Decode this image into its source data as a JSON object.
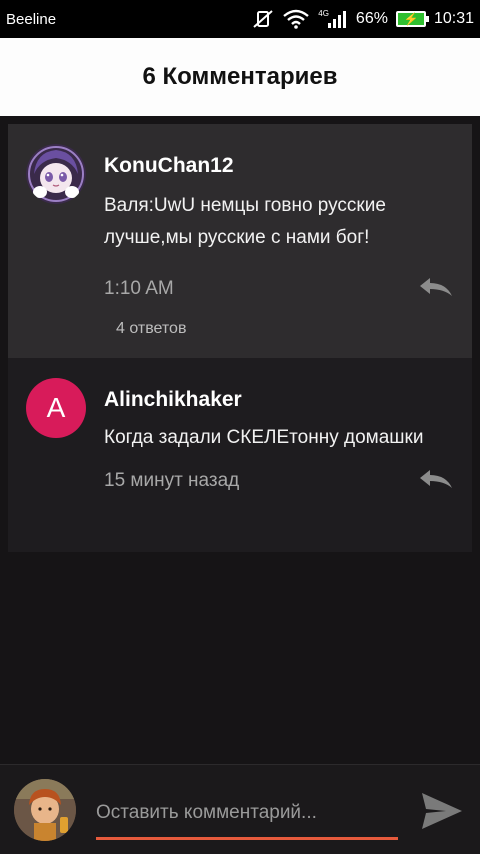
{
  "statusbar": {
    "carrier": "Beeline",
    "network": "4G",
    "battery": "66%",
    "time": "10:31"
  },
  "header": {
    "title": "6 Комментариев"
  },
  "comments": [
    {
      "author": "KonuChan12",
      "text": "Валя:UwU немцы говно русские лучше,мы русские с нами бог!",
      "time": "1:10 AM",
      "replies": "4 ответов",
      "avatar_icon": "anime-avatar"
    },
    {
      "author": "Alinchikhaker",
      "avatar_letter": "A",
      "text": "Когда задали СКЕЛЕтонну домашки",
      "time": "15 минут назад"
    }
  ],
  "input": {
    "placeholder": "Оставить комментарий..."
  },
  "colors": {
    "accent_underline": "#e65a3c",
    "avatar_letter_bg": "#d81b5a",
    "battery_green": "#2fbf2f"
  }
}
